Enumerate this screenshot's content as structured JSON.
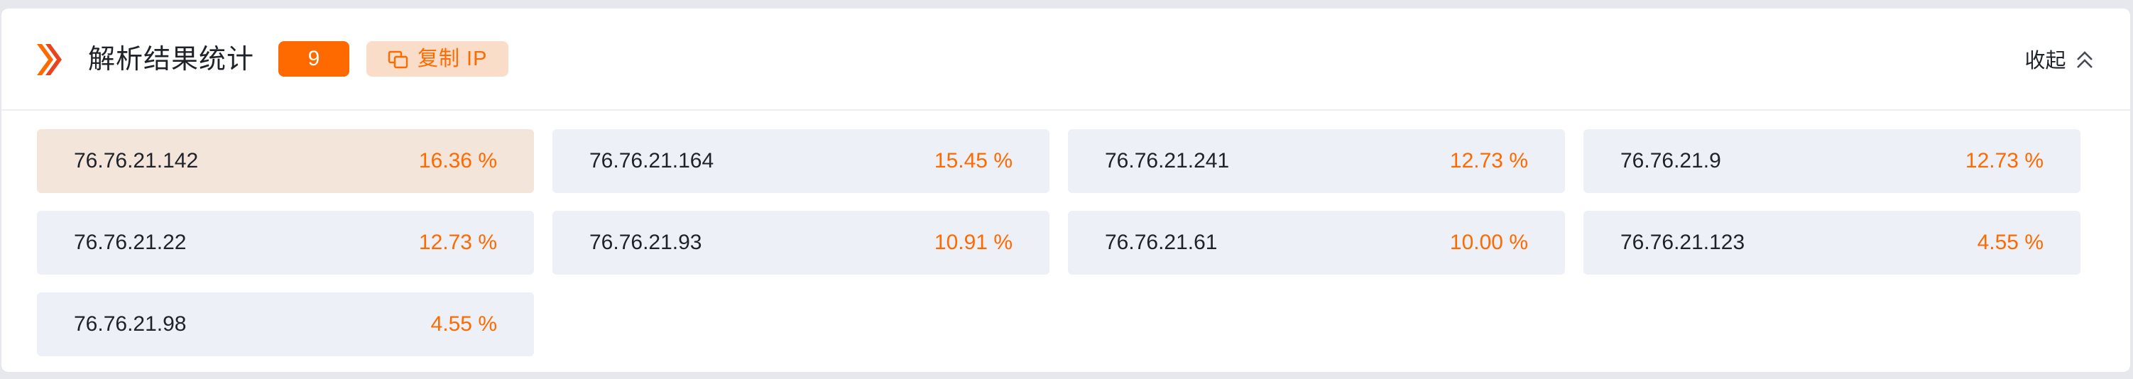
{
  "header": {
    "title": "解析结果统计",
    "count": "9",
    "copy_label": "复制 IP",
    "collapse_label": "收起"
  },
  "colors": {
    "accent": "#ff6a00",
    "active_cell_bg": "#f4e5da",
    "cell_bg": "#edf0f7",
    "copy_button_bg": "#f9ddc9"
  },
  "icons": {
    "logo": "double-chevron-right-icon",
    "copy": "copy-icon",
    "collapse": "double-chevron-up-icon"
  },
  "results": [
    {
      "ip": "76.76.21.142",
      "percent": "16.36 %",
      "selected": true
    },
    {
      "ip": "76.76.21.164",
      "percent": "15.45 %",
      "selected": false
    },
    {
      "ip": "76.76.21.241",
      "percent": "12.73 %",
      "selected": false
    },
    {
      "ip": "76.76.21.9",
      "percent": "12.73 %",
      "selected": false
    },
    {
      "ip": "76.76.21.22",
      "percent": "12.73 %",
      "selected": false
    },
    {
      "ip": "76.76.21.93",
      "percent": "10.91 %",
      "selected": false
    },
    {
      "ip": "76.76.21.61",
      "percent": "10.00 %",
      "selected": false
    },
    {
      "ip": "76.76.21.123",
      "percent": "4.55 %",
      "selected": false
    },
    {
      "ip": "76.76.21.98",
      "percent": "4.55 %",
      "selected": false
    }
  ]
}
